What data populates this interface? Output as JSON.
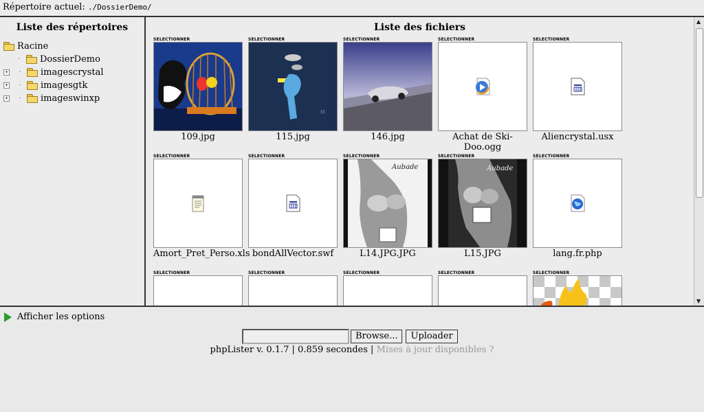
{
  "header": {
    "label": "Répertoire actuel:",
    "path": "./DossierDemo/"
  },
  "sidebar": {
    "title": "Liste des répertoires",
    "root": "Racine",
    "items": [
      {
        "label": "DossierDemo",
        "expandable": false
      },
      {
        "label": "imagescrystal",
        "expandable": true
      },
      {
        "label": "imagesgtk",
        "expandable": true
      },
      {
        "label": "imageswinxp",
        "expandable": true
      }
    ]
  },
  "main": {
    "title": "Liste des fichiers",
    "select_label": "SELECTIONNER",
    "files": [
      {
        "name": "109.jpg",
        "kind": "image-cartoon-cat"
      },
      {
        "name": "115.jpg",
        "kind": "image-blue-cartoon"
      },
      {
        "name": "146.jpg",
        "kind": "image-car"
      },
      {
        "name": "Achat de Ski-Doo.ogg",
        "kind": "media-icon"
      },
      {
        "name": "Aliencrystal.usx",
        "kind": "doc-icon"
      },
      {
        "name": "Amort_Pret_Perso.xls",
        "kind": "text-icon"
      },
      {
        "name": "bondAllVector.swf",
        "kind": "doc-icon"
      },
      {
        "name": "L14.JPG.JPG",
        "kind": "image-bw-aubade"
      },
      {
        "name": "L15.JPG",
        "kind": "image-bw-aubade"
      },
      {
        "name": "lang.fr.php",
        "kind": "web-icon"
      },
      {
        "name": "",
        "kind": "blank"
      },
      {
        "name": "",
        "kind": "blank"
      },
      {
        "name": "",
        "kind": "blank"
      },
      {
        "name": "",
        "kind": "blank"
      },
      {
        "name": "",
        "kind": "image-fire"
      }
    ]
  },
  "options": {
    "label": "Afficher les options"
  },
  "upload": {
    "browse": "Browse...",
    "upload": "Uploader"
  },
  "footer": {
    "text": "phpLister v. 0.1.7 | 0.859 secondes |",
    "link": "Mises à jour disponibles ?"
  },
  "colors": {
    "accent_green": "#2e9a2e",
    "folder_yellow": "#f3d86a",
    "link_gray": "#999999"
  }
}
